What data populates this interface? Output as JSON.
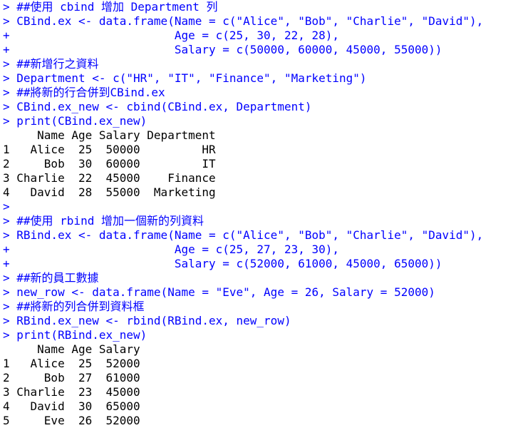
{
  "console": {
    "lines": [
      {
        "prompt": "> ",
        "text": "##使用 cbind 增加 Department 列",
        "kind": "cmd"
      },
      {
        "prompt": "> ",
        "text": "CBind.ex <- data.frame(Name = c(\"Alice\", \"Bob\", \"Charlie\", \"David\"),",
        "kind": "cmd"
      },
      {
        "prompt": "+ ",
        "text": "                       Age = c(25, 30, 22, 28),",
        "kind": "cmd"
      },
      {
        "prompt": "+ ",
        "text": "                       Salary = c(50000, 60000, 45000, 55000))",
        "kind": "cmd"
      },
      {
        "prompt": "> ",
        "text": "##新增行之資料",
        "kind": "cmd"
      },
      {
        "prompt": "> ",
        "text": "Department <- c(\"HR\", \"IT\", \"Finance\", \"Marketing\")",
        "kind": "cmd"
      },
      {
        "prompt": "> ",
        "text": "##將新的行合併到CBind.ex",
        "kind": "cmd"
      },
      {
        "prompt": "> ",
        "text": "CBind.ex_new <- cbind(CBind.ex, Department)",
        "kind": "cmd"
      },
      {
        "prompt": "> ",
        "text": "print(CBind.ex_new)",
        "kind": "cmd"
      },
      {
        "prompt": "",
        "text": "     Name Age Salary Department",
        "kind": "out"
      },
      {
        "prompt": "",
        "text": "1   Alice  25  50000         HR",
        "kind": "out"
      },
      {
        "prompt": "",
        "text": "2     Bob  30  60000         IT",
        "kind": "out"
      },
      {
        "prompt": "",
        "text": "3 Charlie  22  45000    Finance",
        "kind": "out"
      },
      {
        "prompt": "",
        "text": "4   David  28  55000  Marketing",
        "kind": "out"
      },
      {
        "prompt": "> ",
        "text": "",
        "kind": "cmd"
      },
      {
        "prompt": "> ",
        "text": "##使用 rbind 增加一個新的列資料",
        "kind": "cmd"
      },
      {
        "prompt": "> ",
        "text": "RBind.ex <- data.frame(Name = c(\"Alice\", \"Bob\", \"Charlie\", \"David\"),",
        "kind": "cmd"
      },
      {
        "prompt": "+ ",
        "text": "                       Age = c(25, 27, 23, 30),",
        "kind": "cmd"
      },
      {
        "prompt": "+ ",
        "text": "                       Salary = c(52000, 61000, 45000, 65000))",
        "kind": "cmd"
      },
      {
        "prompt": "> ",
        "text": "##新的員工數據",
        "kind": "cmd"
      },
      {
        "prompt": "> ",
        "text": "new_row <- data.frame(Name = \"Eve\", Age = 26, Salary = 52000)",
        "kind": "cmd"
      },
      {
        "prompt": "> ",
        "text": "##將新的列合併到資料框",
        "kind": "cmd"
      },
      {
        "prompt": "> ",
        "text": "RBind.ex_new <- rbind(RBind.ex, new_row)",
        "kind": "cmd"
      },
      {
        "prompt": "> ",
        "text": "print(RBind.ex_new)",
        "kind": "cmd"
      },
      {
        "prompt": "",
        "text": "     Name Age Salary",
        "kind": "out"
      },
      {
        "prompt": "",
        "text": "1   Alice  25  52000",
        "kind": "out"
      },
      {
        "prompt": "",
        "text": "2     Bob  27  61000",
        "kind": "out"
      },
      {
        "prompt": "",
        "text": "3 Charlie  23  45000",
        "kind": "out"
      },
      {
        "prompt": "",
        "text": "4   David  30  65000",
        "kind": "out"
      },
      {
        "prompt": "",
        "text": "5     Eve  26  52000",
        "kind": "out"
      }
    ]
  }
}
